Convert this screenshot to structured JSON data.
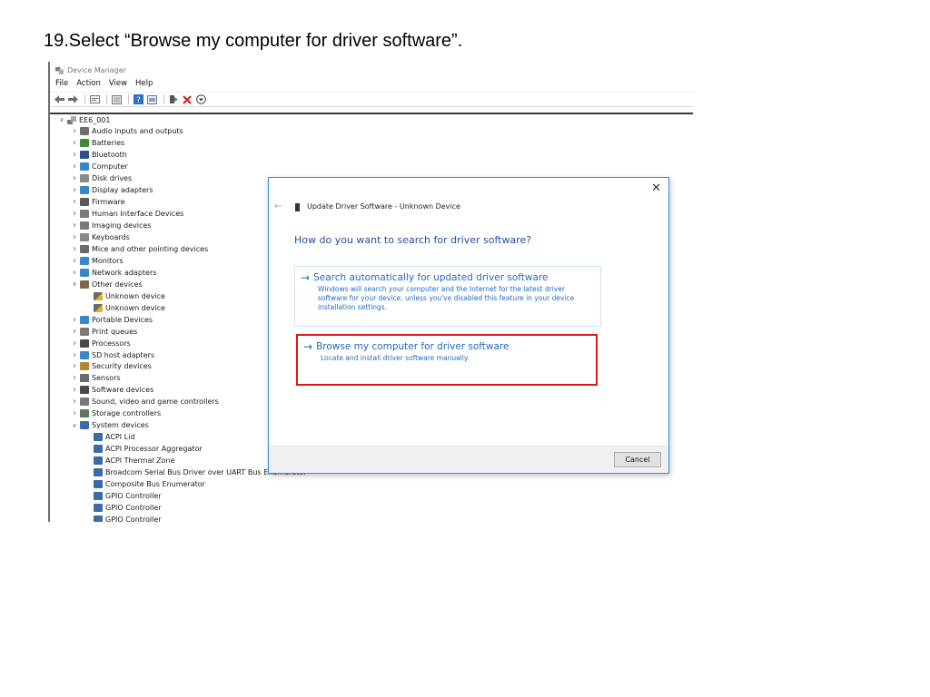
{
  "instruction": "19.Select “Browse my computer for driver software”.",
  "device_manager": {
    "title": "Device Manager",
    "menu": [
      "File",
      "Action",
      "View",
      "Help"
    ],
    "toolbar_icons": [
      "back-icon",
      "forward-icon",
      "properties-icon",
      "view-icon",
      "help-icon",
      "scan-icon",
      "update-driver-icon",
      "uninstall-icon",
      "download-icon"
    ],
    "root": "EE6_001",
    "tree": [
      {
        "label": "Audio inputs and outputs",
        "level": 1,
        "expanded": false,
        "icon": "speaker-icon",
        "color": "#6f6f6f"
      },
      {
        "label": "Batteries",
        "level": 1,
        "expanded": false,
        "icon": "battery-icon",
        "color": "#3f8a3a"
      },
      {
        "label": "Bluetooth",
        "level": 1,
        "expanded": false,
        "icon": "bluetooth-icon",
        "color": "#2a4e8f"
      },
      {
        "label": "Computer",
        "level": 1,
        "expanded": false,
        "icon": "computer-icon",
        "color": "#3a87c8"
      },
      {
        "label": "Disk drives",
        "level": 1,
        "expanded": false,
        "icon": "disk-icon",
        "color": "#8a8a8a"
      },
      {
        "label": "Display adapters",
        "level": 1,
        "expanded": false,
        "icon": "display-icon",
        "color": "#3a87c8"
      },
      {
        "label": "Firmware",
        "level": 1,
        "expanded": false,
        "icon": "chip-icon",
        "color": "#5a5a5a"
      },
      {
        "label": "Human Interface Devices",
        "level": 1,
        "expanded": false,
        "icon": "hid-icon",
        "color": "#7a7a7a"
      },
      {
        "label": "Imaging devices",
        "level": 1,
        "expanded": false,
        "icon": "camera-icon",
        "color": "#7a7a7a"
      },
      {
        "label": "Keyboards",
        "level": 1,
        "expanded": false,
        "icon": "keyboard-icon",
        "color": "#8a8a8a"
      },
      {
        "label": "Mice and other pointing devices",
        "level": 1,
        "expanded": false,
        "icon": "mouse-icon",
        "color": "#6a6a6a"
      },
      {
        "label": "Monitors",
        "level": 1,
        "expanded": false,
        "icon": "monitor-icon",
        "color": "#3a87c8"
      },
      {
        "label": "Network adapters",
        "level": 1,
        "expanded": false,
        "icon": "network-icon",
        "color": "#3a87c8"
      },
      {
        "label": "Other devices",
        "level": 1,
        "expanded": true,
        "icon": "unknown-icon",
        "color": "#7a6a4a"
      },
      {
        "label": "Unknown device",
        "level": 2,
        "expanded": null,
        "icon": "warning-device-icon",
        "color": "#c89a2a"
      },
      {
        "label": "Unknown device",
        "level": 2,
        "expanded": null,
        "icon": "warning-device-icon",
        "color": "#c89a2a"
      },
      {
        "label": "Portable Devices",
        "level": 1,
        "expanded": false,
        "icon": "portable-icon",
        "color": "#3a87c8"
      },
      {
        "label": "Print queues",
        "level": 1,
        "expanded": false,
        "icon": "printer-icon",
        "color": "#7a7a7a"
      },
      {
        "label": "Processors",
        "level": 1,
        "expanded": false,
        "icon": "processor-icon",
        "color": "#4a4a4a"
      },
      {
        "label": "SD host adapters",
        "level": 1,
        "expanded": false,
        "icon": "sd-icon",
        "color": "#3a87c8"
      },
      {
        "label": "Security devices",
        "level": 1,
        "expanded": false,
        "icon": "security-icon",
        "color": "#b08a2a"
      },
      {
        "label": "Sensors",
        "level": 1,
        "expanded": false,
        "icon": "sensor-icon",
        "color": "#6a6a6a"
      },
      {
        "label": "Software devices",
        "level": 1,
        "expanded": false,
        "icon": "software-icon",
        "color": "#4a4a4a"
      },
      {
        "label": "Sound, video and game controllers",
        "level": 1,
        "expanded": false,
        "icon": "sound-icon",
        "color": "#7a7a7a"
      },
      {
        "label": "Storage controllers",
        "level": 1,
        "expanded": false,
        "icon": "storage-icon",
        "color": "#5a7a5a"
      },
      {
        "label": "System devices",
        "level": 1,
        "expanded": true,
        "icon": "folder-icon",
        "color": "#3a6aa8"
      },
      {
        "label": "ACPI Lid",
        "level": 2,
        "expanded": null,
        "icon": "folder-icon",
        "color": "#3a6aa8"
      },
      {
        "label": "ACPI Processor Aggregator",
        "level": 2,
        "expanded": null,
        "icon": "folder-icon",
        "color": "#3a6aa8"
      },
      {
        "label": "ACPI Thermal Zone",
        "level": 2,
        "expanded": null,
        "icon": "folder-icon",
        "color": "#3a6aa8"
      },
      {
        "label": "Broadcom Serial Bus Driver over UART Bus Enumerator",
        "level": 2,
        "expanded": null,
        "icon": "folder-icon",
        "color": "#3a6aa8"
      },
      {
        "label": "Composite Bus Enumerator",
        "level": 2,
        "expanded": null,
        "icon": "folder-icon",
        "color": "#3a6aa8"
      },
      {
        "label": "GPIO Controller",
        "level": 2,
        "expanded": null,
        "icon": "folder-icon",
        "color": "#3a6aa8"
      },
      {
        "label": "GPIO Controller",
        "level": 2,
        "expanded": null,
        "icon": "folder-icon",
        "color": "#3a6aa8"
      },
      {
        "label": "GPIO Controller",
        "level": 2,
        "expanded": null,
        "icon": "folder-icon",
        "color": "#3a6aa8"
      }
    ]
  },
  "dialog": {
    "caption": "Update Driver Software - Unknown Device",
    "question": "How do you want to search for driver software?",
    "option_auto": {
      "title": "Search automatically for updated driver software",
      "description": "Windows will search your computer and the Internet for the latest driver software for your device, unless you've disabled this feature in your device installation settings."
    },
    "option_browse": {
      "title": "Browse my computer for driver software",
      "description": "Locate and install driver software manually."
    },
    "cancel_label": "Cancel",
    "close_glyph": "✕",
    "back_glyph": "←",
    "arrow_glyph": "→",
    "accent_color": "#1f6ac2",
    "highlight_color": "#d81a1a"
  }
}
